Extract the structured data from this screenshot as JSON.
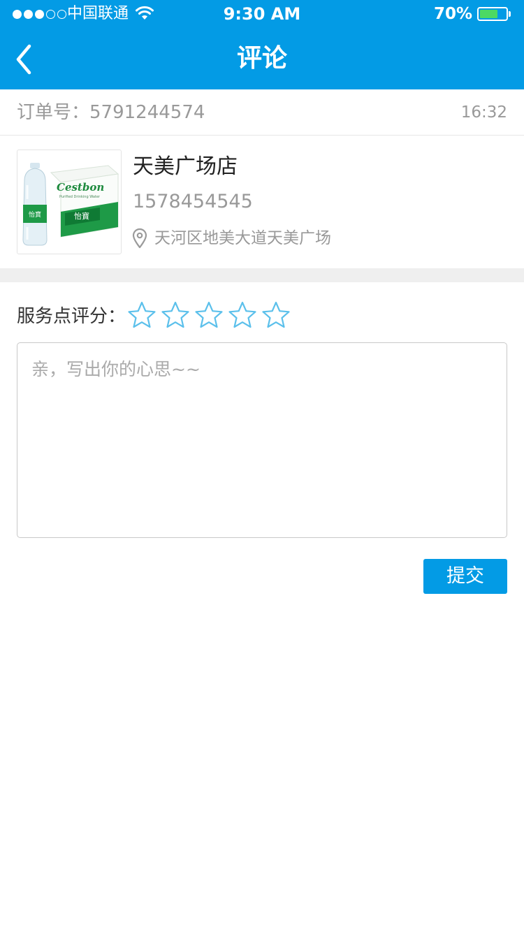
{
  "status_bar": {
    "carrier": "中国联通",
    "time": "9:30 AM",
    "battery": "70%",
    "battery_level": 0.7,
    "signal_bars": 3,
    "signal_total": 5
  },
  "header": {
    "title": "评论",
    "back_icon": "chevron-left-icon"
  },
  "order": {
    "label_number": "订单号：5791244574",
    "time": "16:32"
  },
  "store": {
    "name": "天美广场店",
    "phone": "1578454545",
    "address": "天河区地美大道天美广场",
    "image": {
      "brand_text": "Cestbon",
      "brand_sub": "Purified Drinking Water",
      "cn_text": "怡寶"
    }
  },
  "rating": {
    "label": "服务点评分：",
    "max": 5,
    "value": 0
  },
  "comment": {
    "placeholder": "亲，写出你的心思~~",
    "value": ""
  },
  "submit": {
    "label": "提交"
  },
  "colors": {
    "primary": "#039be5",
    "star": "#5bc0eb",
    "battery_fill": "#4cd964"
  }
}
